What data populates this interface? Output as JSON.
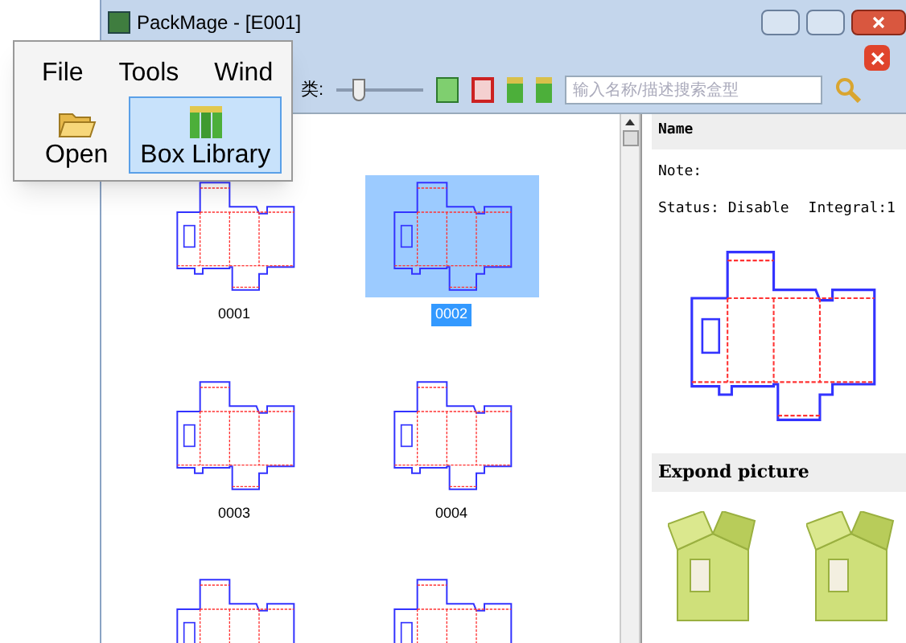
{
  "window": {
    "title": "PackMage - [E001]"
  },
  "toolbar": {
    "category_label": "类:",
    "zoom": {
      "level": 0.25
    },
    "search": {
      "placeholder": "输入名称/描述搜索盒型"
    }
  },
  "callout": {
    "menu": [
      "File",
      "Tools",
      "Wind"
    ],
    "ribbon": [
      {
        "label": "Open",
        "kind": "folder",
        "selected": false
      },
      {
        "label": "Box Library",
        "kind": "books",
        "selected": true
      }
    ]
  },
  "library": {
    "items": [
      {
        "label": "0001",
        "selected": false
      },
      {
        "label": "0002",
        "selected": true
      },
      {
        "label": "0003",
        "selected": false
      },
      {
        "label": "0004",
        "selected": false
      },
      {
        "selected": false
      },
      {
        "selected": false
      }
    ]
  },
  "details": {
    "name_header": "Name",
    "note": "Note:",
    "status": "Status: Disable",
    "integral": "Integral:1",
    "expand_header": "Expond picture"
  }
}
